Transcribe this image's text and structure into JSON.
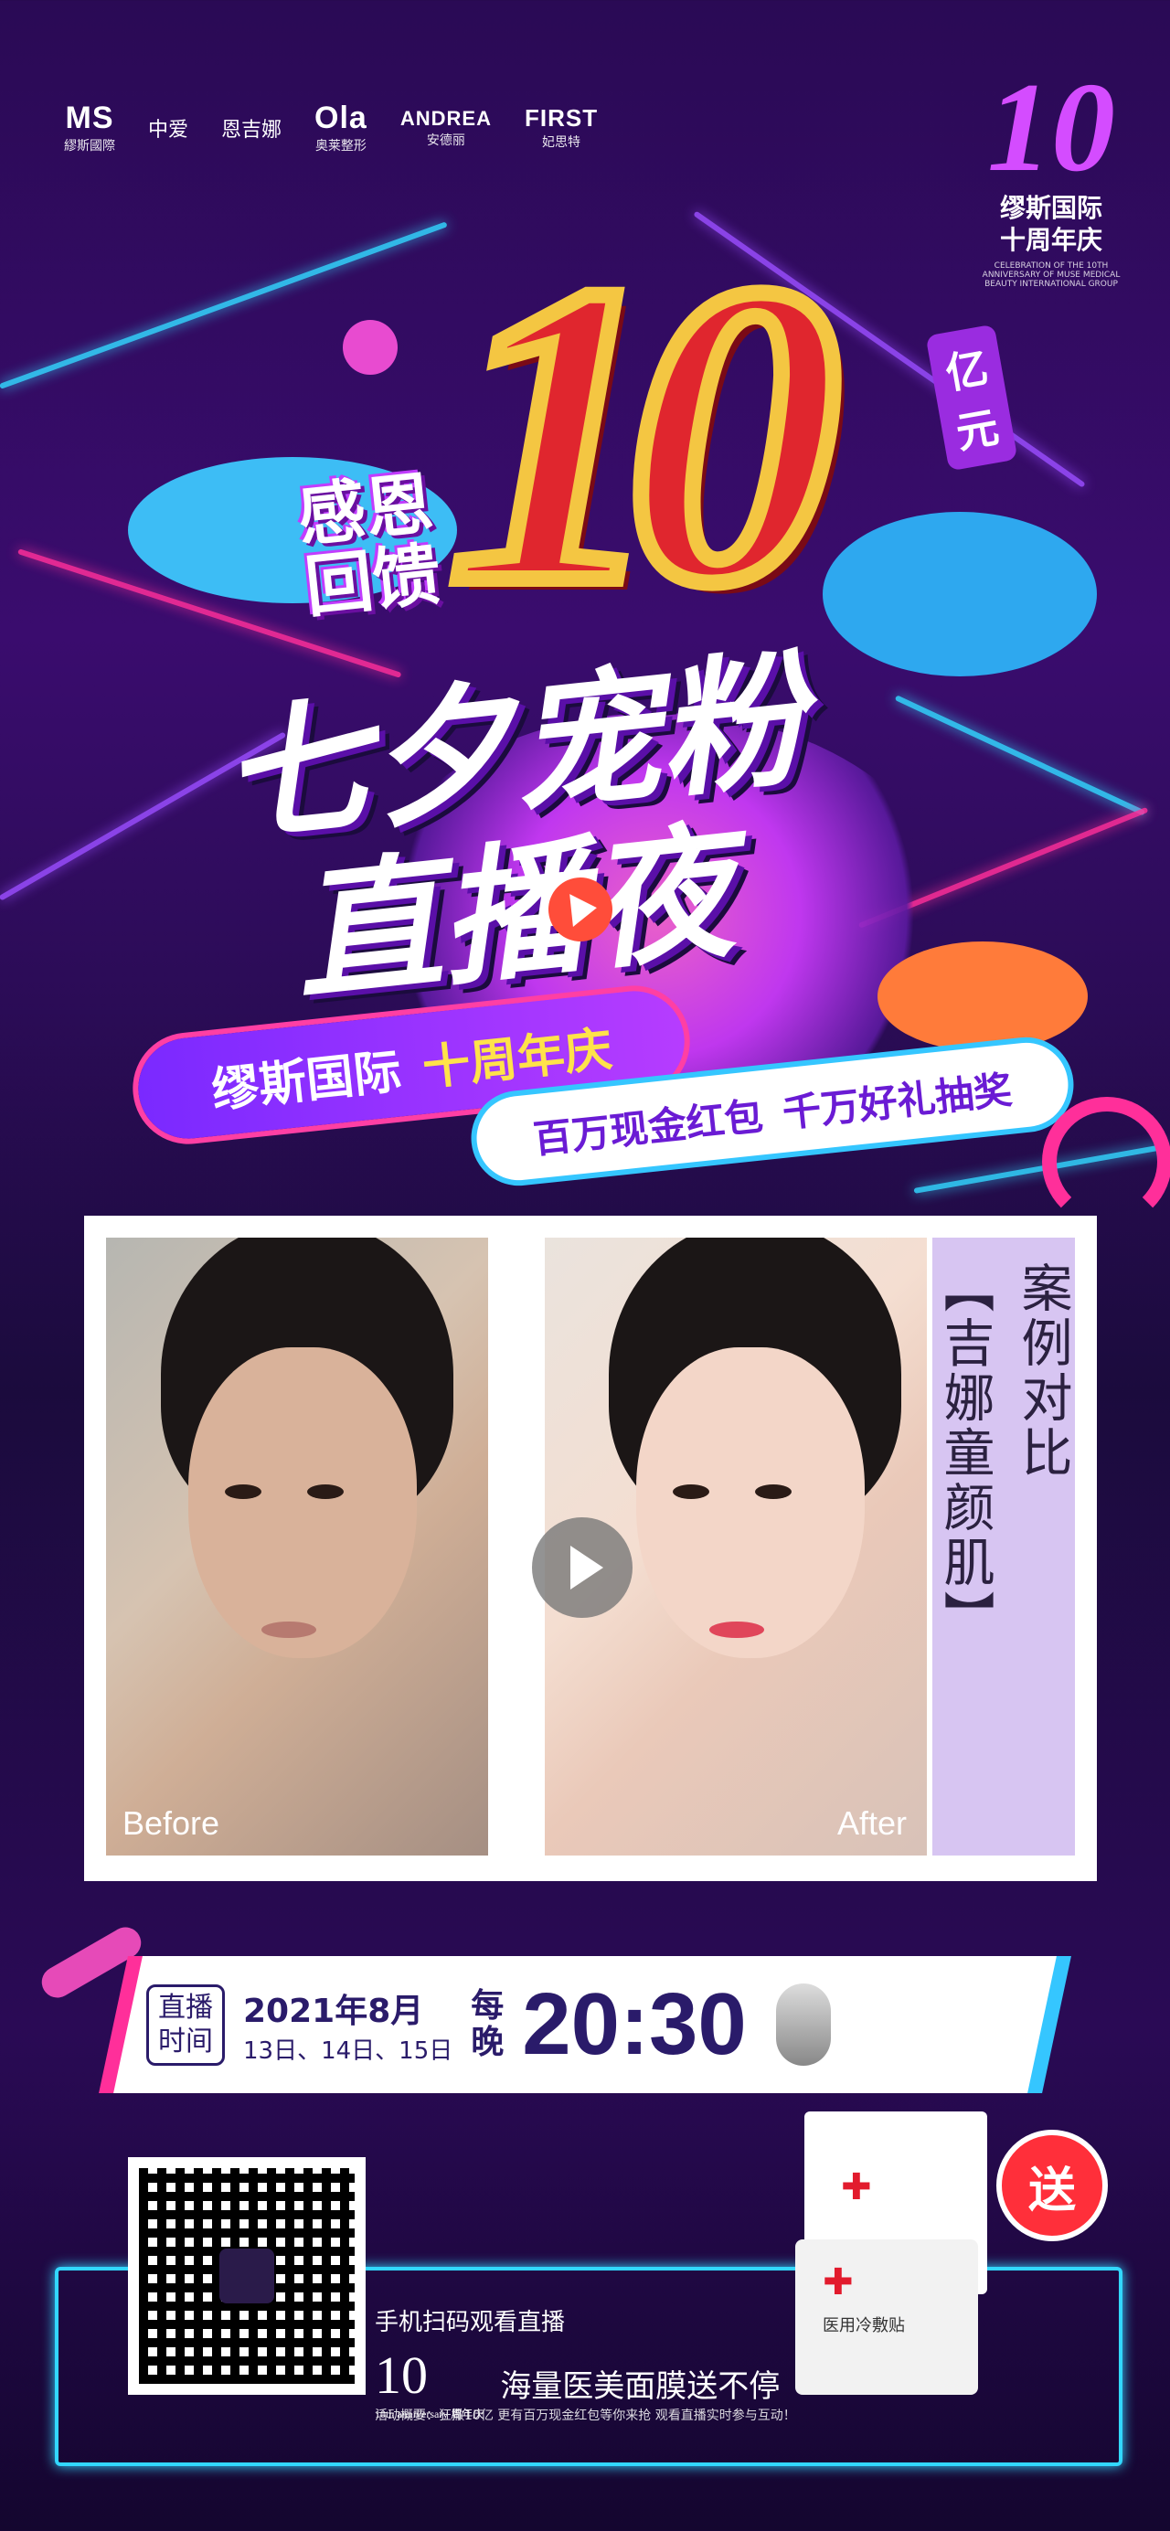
{
  "header": {
    "logos": [
      {
        "main": "MS",
        "sub": "繆斯國際"
      },
      {
        "main": "中爱",
        "sub": ""
      },
      {
        "main": "恩吉娜",
        "sub": ""
      },
      {
        "main": "Ola",
        "sub": "奥莱整形"
      },
      {
        "main": "ANDREA",
        "sub": "安德丽"
      },
      {
        "main": "FIRST",
        "sub": "妃思特"
      }
    ],
    "anniversary": {
      "number": "10",
      "title_line1": "缪斯国际",
      "title_line2": "十周年庆",
      "caption": "CELEBRATION OF THE 10TH ANNIVERSARY OF MUSE MEDICAL BEAUTY INTERNATIONAL GROUP"
    }
  },
  "hero": {
    "big_number": "10",
    "unit_line1": "亿",
    "unit_line2": "元",
    "tagline_line1": "感恩",
    "tagline_line2": "回馈",
    "headline_line1": "七夕宠粉",
    "headline_line2": "直播夜",
    "ribbon1_a": "缪斯国际",
    "ribbon1_b": "十周年庆",
    "ribbon2_a": "百万现金红包",
    "ribbon2_b": "千万好礼抽奖"
  },
  "comparison": {
    "before_label": "Before",
    "after_label": "After",
    "title_col1": "【吉娜童颜肌】",
    "title_col2": "案例对比"
  },
  "schedule": {
    "box_line1": "直播",
    "box_line2": "时间",
    "date_line1": "2021年8月",
    "date_line2": "13日、14日、15日",
    "every_line1": "每",
    "every_line2": "晚",
    "time": "20:30"
  },
  "footer": {
    "scan_text": "手机扫码观看直播",
    "logo_number": "10",
    "logo_sub": "10th anniversary 周年庆",
    "mask_text": "海量医美面膜送不停",
    "description": "活动概要：狂撒10亿 更有百万现金红包等你来抢 观看直播实时参与互动！",
    "gift_badge": "送",
    "pack_label": "医用冷敷贴"
  },
  "colors": {
    "accent_pink": "#ff2f9a",
    "accent_cyan": "#32d7ff",
    "accent_purple": "#9a2ce0",
    "red": "#e0262e",
    "gold": "#f4c642"
  }
}
